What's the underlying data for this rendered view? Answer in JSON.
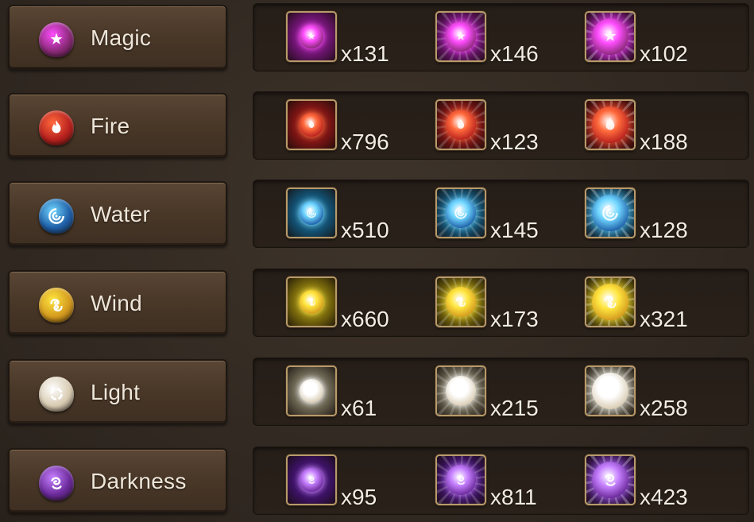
{
  "elements": [
    {
      "name": "Magic",
      "badge_icon": "magic-rune-icon",
      "colors": {
        "badge": "#8a2a78",
        "glow": "#ff4dff",
        "bg": "#6d1470"
      },
      "essences": [
        {
          "tier": "low",
          "count": "x131"
        },
        {
          "tier": "mid",
          "count": "x146"
        },
        {
          "tier": "high",
          "count": "x102"
        }
      ]
    },
    {
      "name": "Fire",
      "badge_icon": "fire-rune-icon",
      "colors": {
        "badge": "#b8211e",
        "glow": "#ff6a3c",
        "bg": "#7a1414"
      },
      "essences": [
        {
          "tier": "low",
          "count": "x796"
        },
        {
          "tier": "mid",
          "count": "x123"
        },
        {
          "tier": "high",
          "count": "x188"
        }
      ]
    },
    {
      "name": "Water",
      "badge_icon": "water-rune-icon",
      "colors": {
        "badge": "#1f5fa8",
        "glow": "#6fd6ff",
        "bg": "#135173"
      },
      "essences": [
        {
          "tier": "low",
          "count": "x510"
        },
        {
          "tier": "mid",
          "count": "x145"
        },
        {
          "tier": "high",
          "count": "x128"
        }
      ]
    },
    {
      "name": "Wind",
      "badge_icon": "wind-rune-icon",
      "colors": {
        "badge": "#d49a1e",
        "glow": "#ffe640",
        "bg": "#7a6a0c"
      },
      "essences": [
        {
          "tier": "low",
          "count": "x660"
        },
        {
          "tier": "mid",
          "count": "x173"
        },
        {
          "tier": "high",
          "count": "x321"
        }
      ]
    },
    {
      "name": "Light",
      "badge_icon": "light-rune-icon",
      "colors": {
        "badge": "#d8cbb2",
        "glow": "#ffffff",
        "bg": "#6b6552"
      },
      "essences": [
        {
          "tier": "low",
          "count": "x61"
        },
        {
          "tier": "mid",
          "count": "x215"
        },
        {
          "tier": "high",
          "count": "x258"
        }
      ]
    },
    {
      "name": "Darkness",
      "badge_icon": "darkness-rune-icon",
      "colors": {
        "badge": "#6b2a9a",
        "glow": "#c680ff",
        "bg": "#3d1266"
      },
      "essences": [
        {
          "tier": "low",
          "count": "x95"
        },
        {
          "tier": "mid",
          "count": "x811"
        },
        {
          "tier": "high",
          "count": "x423"
        }
      ]
    }
  ]
}
